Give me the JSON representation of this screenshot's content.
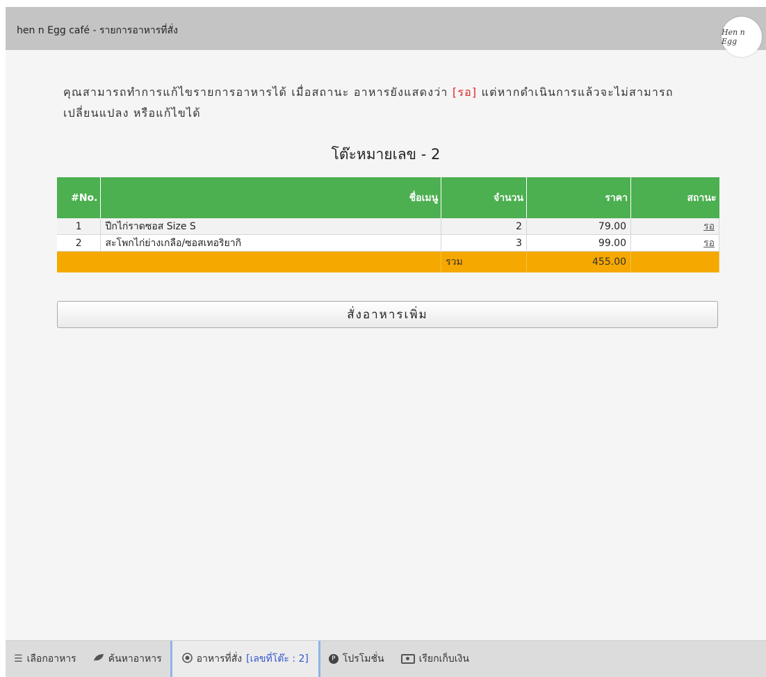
{
  "header": {
    "title": "hen n Egg café - รายการอาหารที่สั่ง",
    "logo_text": "Hen n Egg"
  },
  "notice": {
    "text_before": "คุณสามารถทำการแก้ไขรายการอาหารได้ เมื่อสถานะ อาหารยังแสดงว่า ",
    "status_word": "[รอ]",
    "text_after": " แต่หากดำเนินการแล้วจะไม่สามารถเปลี่ยนแปลง หรือแก้ไขได้"
  },
  "table_heading": "โต๊ะหมายเลข - 2",
  "orders_table": {
    "headers": {
      "no": "#No.",
      "menu": "ชื่อเมนู",
      "qty": "จำนวน",
      "price": "ราคา",
      "status": "สถานะ"
    },
    "rows": [
      {
        "no": "1",
        "menu": "ปีกไก่ราดซอส Size S",
        "qty": "2",
        "price": "79.00",
        "status": "รอ"
      },
      {
        "no": "2",
        "menu": "สะโพกไก่ย่างเกลือ/ซอสเทอริยากิ",
        "qty": "3",
        "price": "99.00",
        "status": "รอ"
      }
    ],
    "total_label": "รวม",
    "total_value": "455.00"
  },
  "order_more_label": "สั่งอาหารเพิ่ม",
  "bottom_nav": {
    "items": [
      {
        "label": "เลือกอาหาร",
        "icon": "menu-icon"
      },
      {
        "label": "ค้นหาอาหาร",
        "icon": "leaf-icon"
      },
      {
        "label": "อาหารที่สั่ง",
        "icon": "orders-icon",
        "extra": "[เลขที่โต๊ะ : 2]"
      },
      {
        "label": "โปรโมชั่น",
        "icon": "promotion-icon"
      },
      {
        "label": "เรียกเก็บเงิน",
        "icon": "bill-icon"
      }
    ]
  },
  "colors": {
    "header_bg": "#c4c4c4",
    "table_header": "#4caf50",
    "total_row": "#f5a800",
    "status_word": "#e0272a"
  }
}
